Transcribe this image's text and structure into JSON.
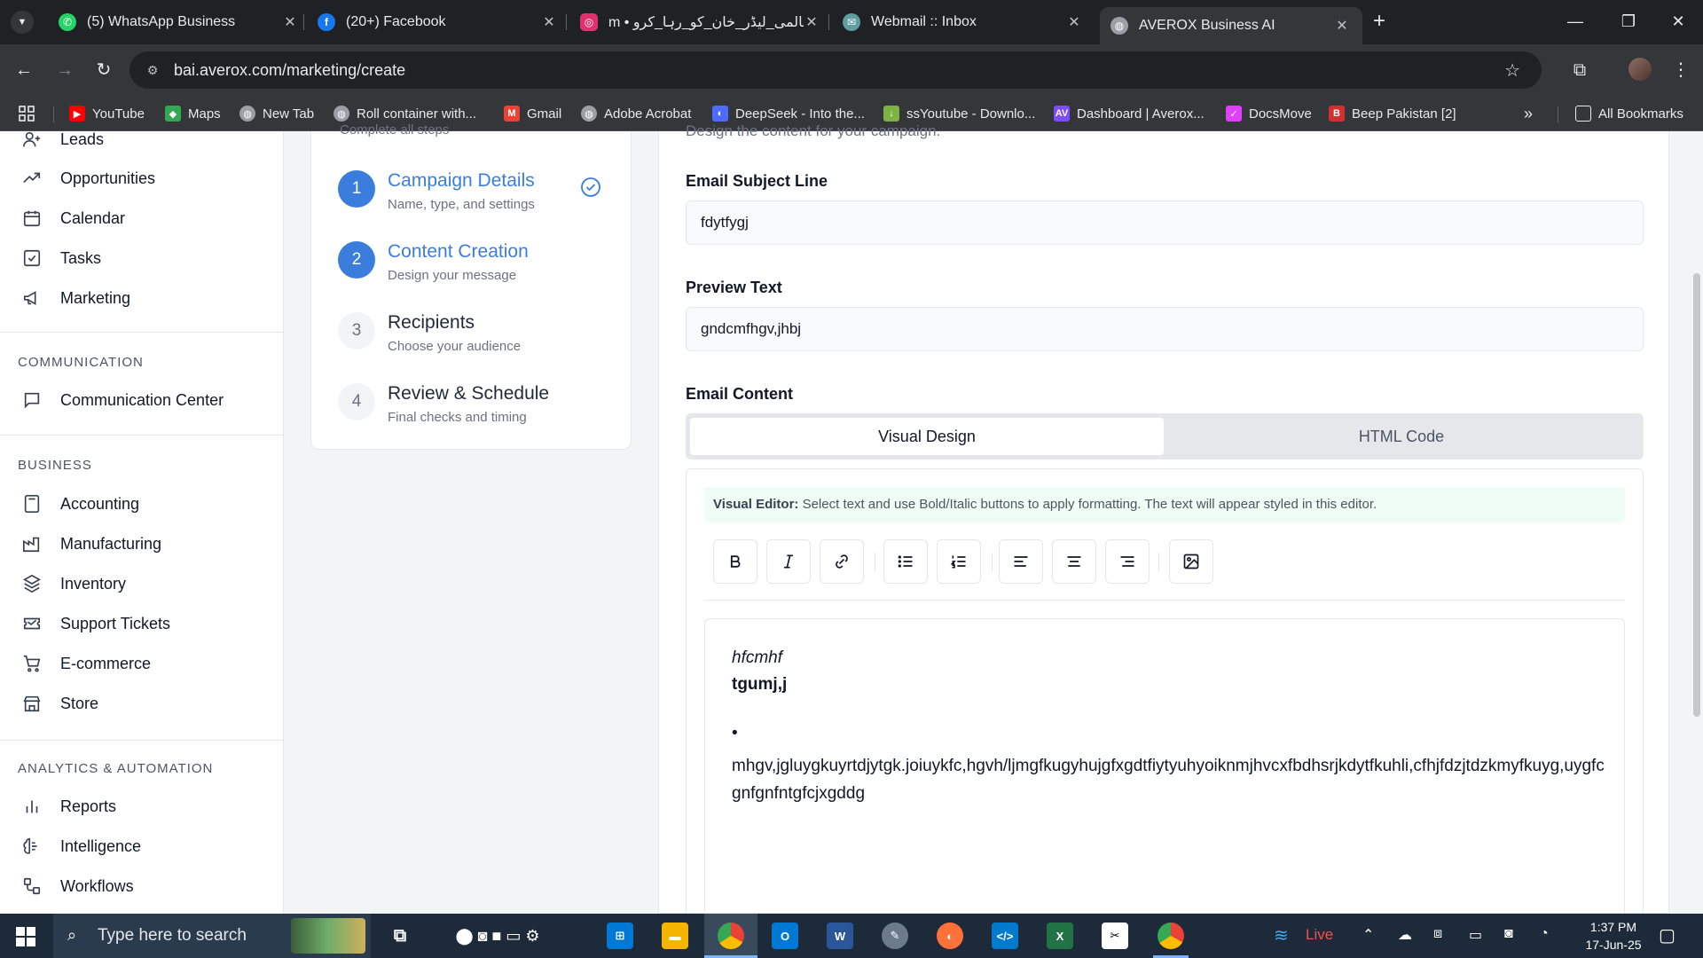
{
  "browser": {
    "tabs": [
      {
        "title": "(5) WhatsApp Business",
        "icon": "whatsapp-icon",
        "color": "#25d366"
      },
      {
        "title": "(20+) Facebook",
        "icon": "facebook-icon",
        "color": "#1877f2"
      },
      {
        "title": "m • عالمی_لیڈر_خان_کو_رہا_کرو#",
        "icon": "instagram-icon",
        "color": "#e1306c"
      },
      {
        "title": "Webmail :: Inbox",
        "icon": "webmail-icon",
        "color": "#5f9ea0"
      },
      {
        "title": "AVEROX Business AI",
        "icon": "globe-icon",
        "color": "#9aa0a6"
      }
    ],
    "url": "bai.averox.com/marketing/create",
    "bookmarks": [
      {
        "label": "YouTube",
        "icon": "youtube-icon",
        "color": "#ff0000"
      },
      {
        "label": "Maps",
        "icon": "maps-icon",
        "color": "#34a853"
      },
      {
        "label": "New Tab",
        "icon": "globe-icon",
        "color": "#9aa0a6"
      },
      {
        "label": "Roll container with...",
        "icon": "globe-icon",
        "color": "#9aa0a6"
      },
      {
        "label": "Gmail",
        "icon": "gmail-icon",
        "color": "#ea4335"
      },
      {
        "label": "Adobe Acrobat",
        "icon": "globe-icon",
        "color": "#9aa0a6"
      },
      {
        "label": "DeepSeek - Into the...",
        "icon": "deepseek-icon",
        "color": "#4d6bfe"
      },
      {
        "label": "ssYoutube - Downlo...",
        "icon": "download-icon",
        "color": "#7cb342"
      },
      {
        "label": "Dashboard | Averox...",
        "icon": "averox-icon",
        "color": "#7c4dff"
      },
      {
        "label": "DocsMove",
        "icon": "docsmove-icon",
        "color": "#e040fb"
      },
      {
        "label": "Beep Pakistan [2]",
        "icon": "beep-icon",
        "color": "#d32f2f"
      }
    ],
    "all_bookmarks": "All Bookmarks"
  },
  "sidebar": {
    "top_items": [
      {
        "label": "Leads",
        "icon": "user-plus-icon"
      },
      {
        "label": "Opportunities",
        "icon": "trending-up-icon"
      },
      {
        "label": "Calendar",
        "icon": "calendar-icon"
      },
      {
        "label": "Tasks",
        "icon": "checkbox-icon"
      },
      {
        "label": "Marketing",
        "icon": "megaphone-icon"
      }
    ],
    "communication_title": "COMMUNICATION",
    "communication_items": [
      {
        "label": "Communication Center",
        "icon": "message-square-icon"
      }
    ],
    "business_title": "BUSINESS",
    "business_items": [
      {
        "label": "Accounting",
        "icon": "calculator-icon"
      },
      {
        "label": "Manufacturing",
        "icon": "factory-icon"
      },
      {
        "label": "Inventory",
        "icon": "boxes-icon"
      },
      {
        "label": "Support Tickets",
        "icon": "ticket-icon"
      },
      {
        "label": "E-commerce",
        "icon": "shopping-cart-icon"
      },
      {
        "label": "Store",
        "icon": "store-icon"
      }
    ],
    "analytics_title": "ANALYTICS & AUTOMATION",
    "analytics_items": [
      {
        "label": "Reports",
        "icon": "bar-chart-icon"
      },
      {
        "label": "Intelligence",
        "icon": "brain-icon"
      },
      {
        "label": "Workflows",
        "icon": "workflow-icon"
      }
    ]
  },
  "steps": {
    "subtitle": "Complete all steps",
    "items": [
      {
        "num": "1",
        "title": "Campaign Details",
        "sub": "Name, type, and settings",
        "state": "completed"
      },
      {
        "num": "2",
        "title": "Content Creation",
        "sub": "Design your message",
        "state": "current"
      },
      {
        "num": "3",
        "title": "Recipients",
        "sub": "Choose your audience",
        "state": "pending"
      },
      {
        "num": "4",
        "title": "Review & Schedule",
        "sub": "Final checks and timing",
        "state": "pending"
      }
    ]
  },
  "form": {
    "subtitle": "Design the content for your campaign.",
    "subject_label": "Email Subject Line",
    "subject_value": "fdytfygj",
    "preview_label": "Preview Text",
    "preview_value": "gndcmfhgv,jhbj",
    "content_label": "Email Content",
    "tabs": {
      "visual": "Visual Design",
      "html": "HTML Code",
      "active": "visual"
    },
    "hint_bold": "Visual Editor:",
    "hint_text": " Select text and use Bold/Italic buttons to apply formatting. The text will appear styled in this editor.",
    "editor_content": {
      "italic_line": "hfcmhf",
      "bold_line": "tgumj,j",
      "bullet": "•",
      "long_text": "mhgv,jgluygkuyrtdjytgk.joiuykfc,hgvh/ljmgfkugyhujgfxgdtfiytyuhyoiknmjhvcxfbdhsrjkdytfkuhli,cfhjfdzjtdzkmyfkuyg,uygfcgnfgnfntgfcjxgddg"
    }
  },
  "taskbar": {
    "search_placeholder": "Type here to search",
    "weather": "Live",
    "time": "1:37 PM",
    "date": "17-Jun-25"
  },
  "colors": {
    "accent": "#3b7ddd",
    "hint_bg": "#f0fdf4"
  }
}
